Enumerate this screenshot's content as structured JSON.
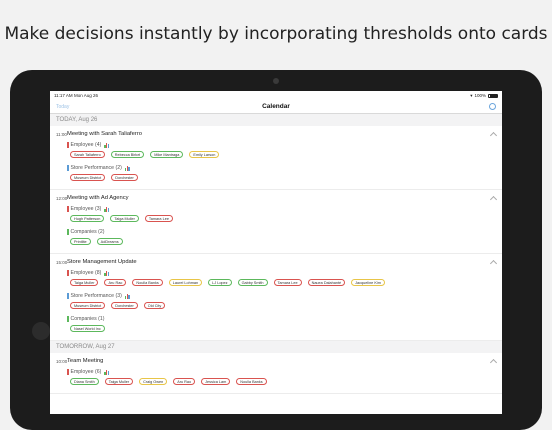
{
  "headline": "Make decisions instantly by incorporating thresholds onto cards",
  "status": {
    "time": "11:17 AM",
    "date": "Mon Aug 26",
    "battery": "100%"
  },
  "nav": {
    "left": "Today",
    "title": "Calendar"
  },
  "colors": {
    "red": "#d9534f",
    "blue": "#5b9bd5",
    "green": "#5cb85c",
    "yellow": "#e8c547"
  },
  "days": [
    {
      "label": "TODAY, Aug 26",
      "meetings": [
        {
          "time": "11:00",
          "title": "Meeting with Sarah Taliaferro",
          "groups": [
            {
              "label": "Employee (4)",
              "bar": "red",
              "icon": true,
              "chips": [
                {
                  "text": "Sarah Taliaferro",
                  "color": "red"
                },
                {
                  "text": "Rebecca Birkel",
                  "color": "green"
                },
                {
                  "text": "Mike Mantraga",
                  "color": "green"
                },
                {
                  "text": "Emily Larson",
                  "color": "yellow"
                }
              ]
            },
            {
              "label": "Store Performance (2)",
              "bar": "blue",
              "icon": true,
              "chips": [
                {
                  "text": "Museum District",
                  "color": "red"
                },
                {
                  "text": "Dorchester",
                  "color": "red"
                }
              ]
            }
          ]
        },
        {
          "time": "12:00",
          "title": "Meeting with Ad Agency",
          "groups": [
            {
              "label": "Employee (3)",
              "bar": "red",
              "icon": true,
              "chips": [
                {
                  "text": "Hugh Patterson",
                  "color": "green"
                },
                {
                  "text": "Taiga Muller",
                  "color": "green"
                },
                {
                  "text": "Tamara Lee",
                  "color": "red"
                }
              ]
            },
            {
              "label": "Companies (2)",
              "bar": "green",
              "icon": false,
              "chips": [
                {
                  "text": "Printlite",
                  "color": "green"
                },
                {
                  "text": "AdDreams",
                  "color": "green"
                }
              ]
            }
          ]
        },
        {
          "time": "15:00",
          "title": "Store Management Update",
          "groups": [
            {
              "label": "Employee (8)",
              "bar": "red",
              "icon": true,
              "chips": [
                {
                  "text": "Taiga Muller",
                  "color": "red"
                },
                {
                  "text": "Aru Rao",
                  "color": "red"
                },
                {
                  "text": "Noulla Banks",
                  "color": "red"
                },
                {
                  "text": "Laurel Lohman",
                  "color": "yellow"
                },
                {
                  "text": "LJ Lopez",
                  "color": "green"
                },
                {
                  "text": "Gabby Smith",
                  "color": "green"
                },
                {
                  "text": "Tamara Lee",
                  "color": "red"
                },
                {
                  "text": "Nauea Dalahanté",
                  "color": "red"
                },
                {
                  "text": "Jacqueline Kim",
                  "color": "yellow"
                }
              ]
            },
            {
              "label": "Store Performance (3)",
              "bar": "blue",
              "icon": true,
              "chips": [
                {
                  "text": "Museum District",
                  "color": "red"
                },
                {
                  "text": "Dorchester",
                  "color": "red"
                },
                {
                  "text": "Old City",
                  "color": "red"
                }
              ]
            },
            {
              "label": "Companies (1)",
              "bar": "green",
              "icon": false,
              "chips": [
                {
                  "text": "Nasel World Inc",
                  "color": "green"
                }
              ]
            }
          ]
        }
      ]
    },
    {
      "label": "TOMORROW, Aug 27",
      "meetings": [
        {
          "time": "10:00",
          "title": "Team Meeting",
          "groups": [
            {
              "label": "Employee (6)",
              "bar": "red",
              "icon": true,
              "chips": [
                {
                  "text": "Diana Smith",
                  "color": "green"
                },
                {
                  "text": "Taiga Muller",
                  "color": "red"
                },
                {
                  "text": "Craig Owen",
                  "color": "yellow"
                },
                {
                  "text": "Aru Rao",
                  "color": "red"
                },
                {
                  "text": "Jessica Lam",
                  "color": "red"
                },
                {
                  "text": "Noulla Banks",
                  "color": "red"
                }
              ]
            }
          ]
        }
      ]
    }
  ]
}
